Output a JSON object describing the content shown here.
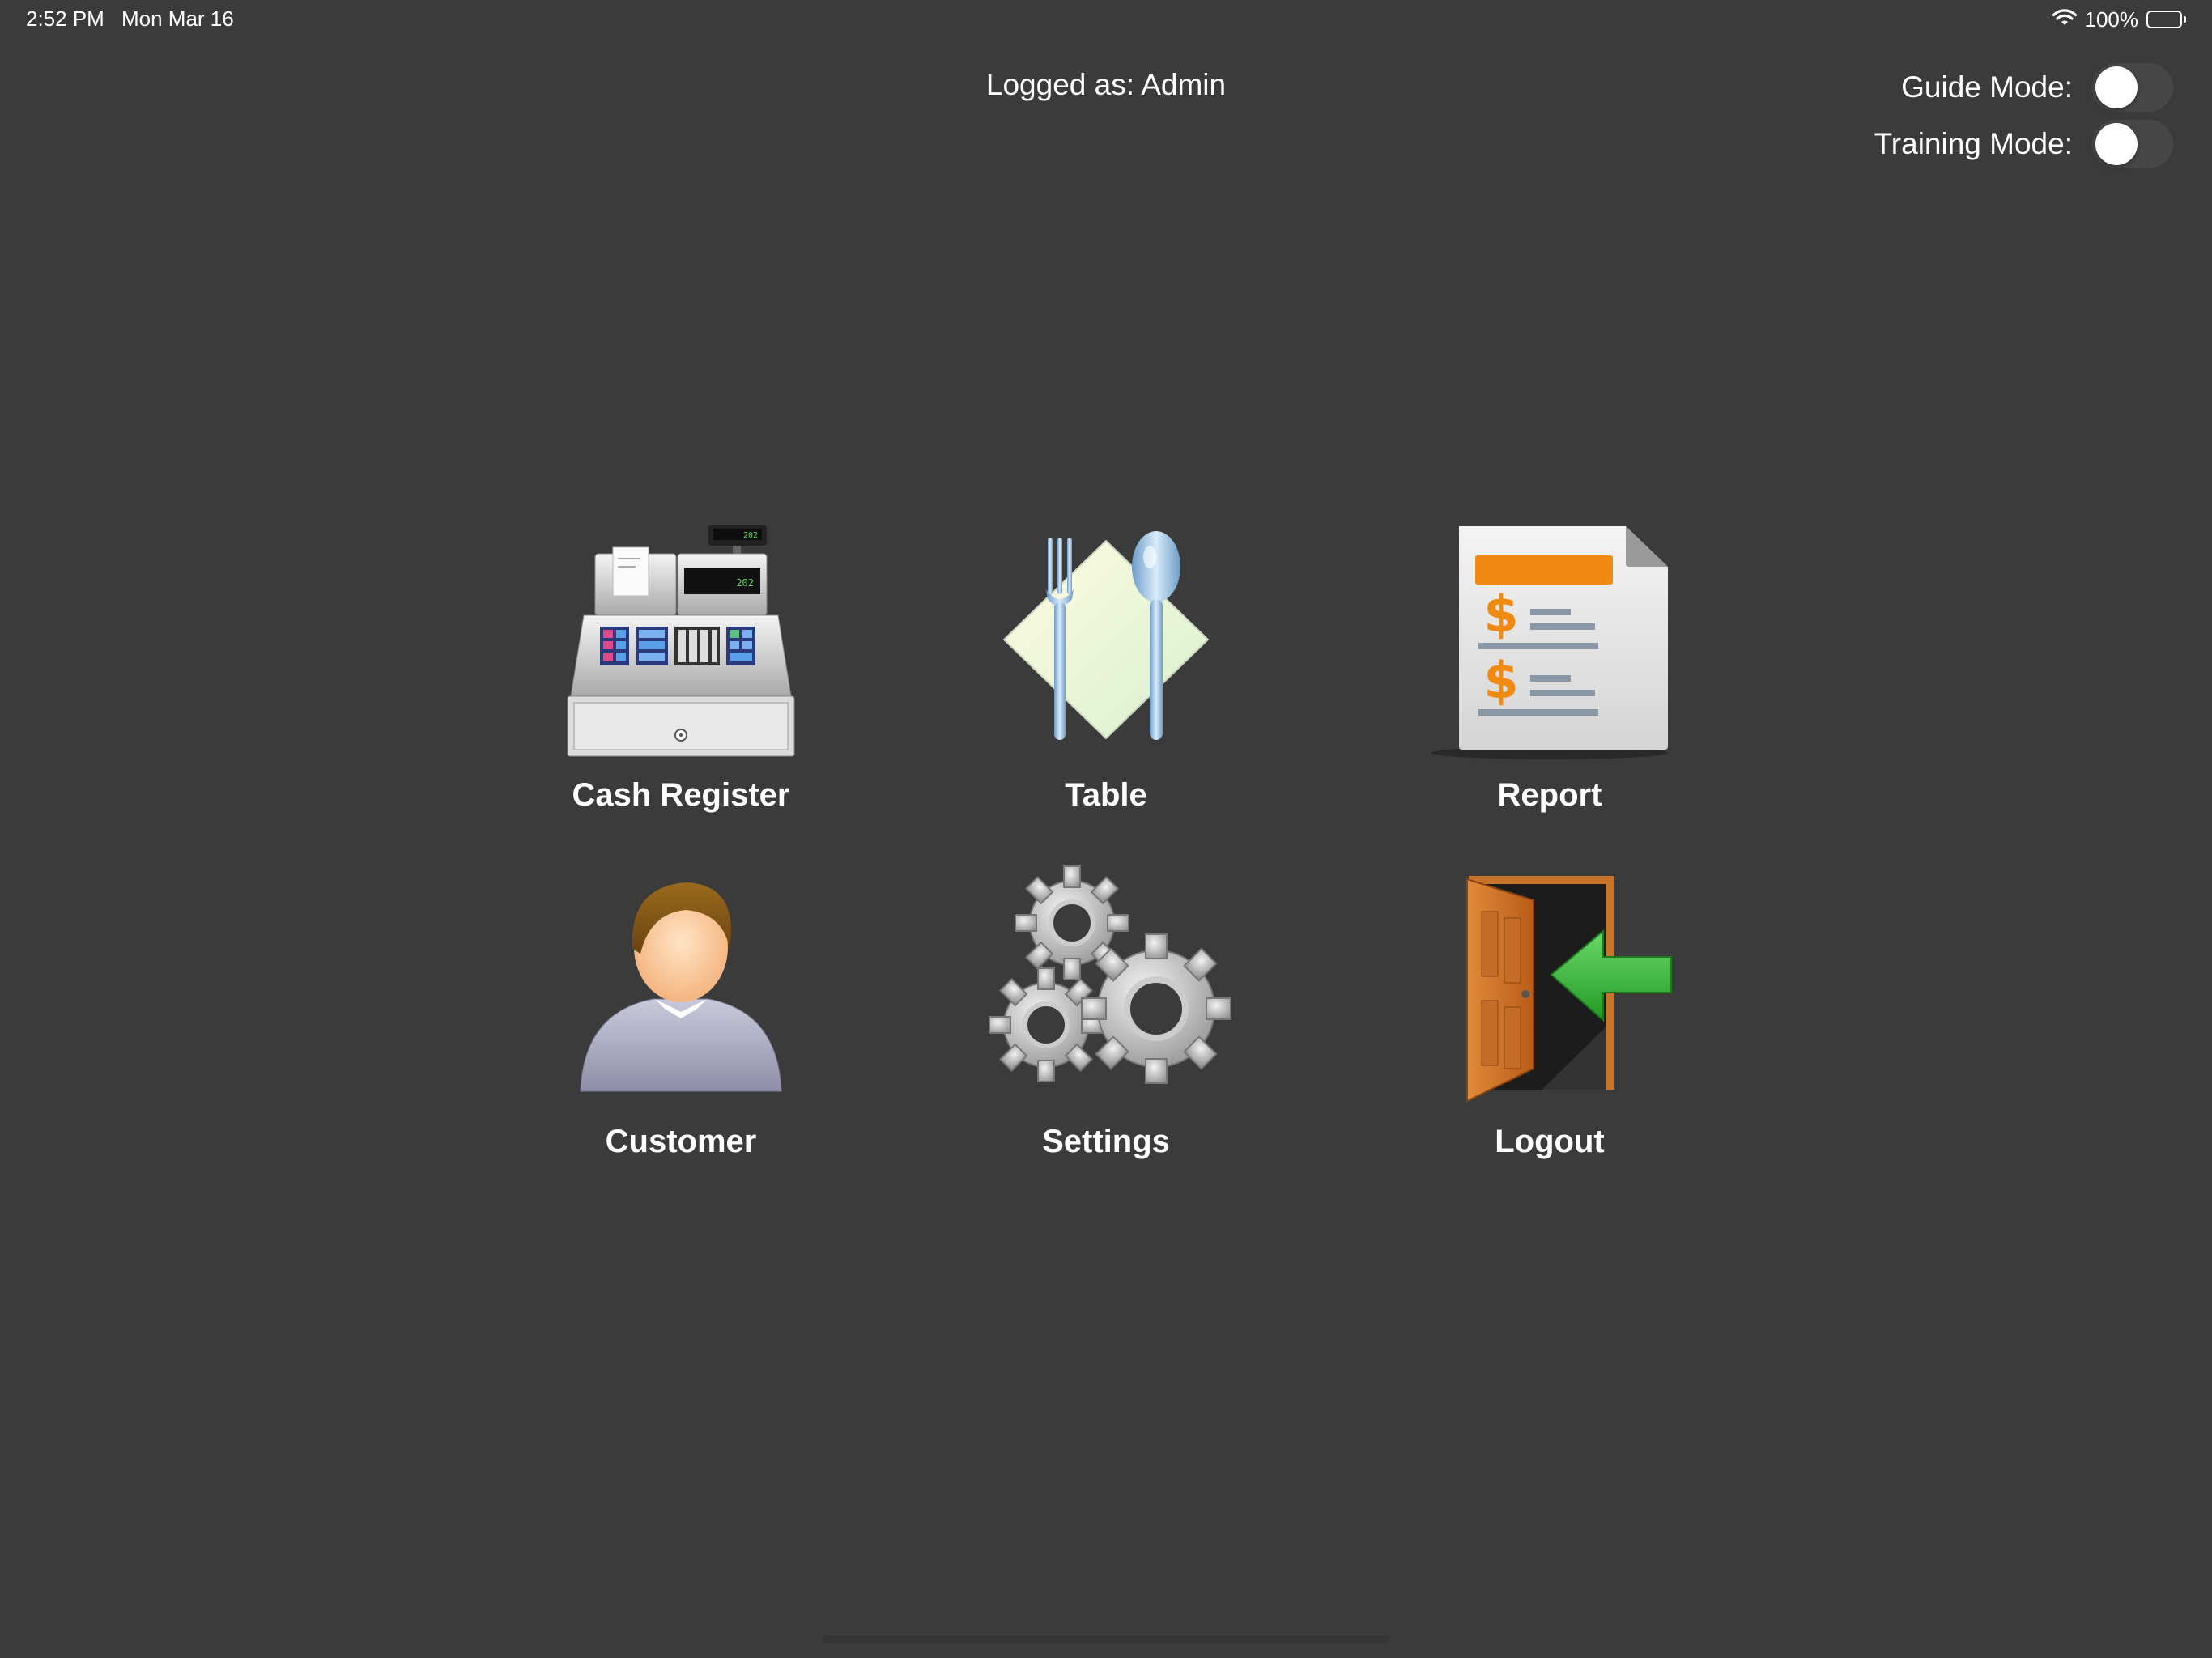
{
  "status_bar": {
    "time": "2:52 PM",
    "date": "Mon Mar 16",
    "battery_percent": "100%",
    "battery_level": 1.0
  },
  "header": {
    "logged_as": "Logged as: Admin"
  },
  "modes": {
    "guide": {
      "label": "Guide Mode:",
      "enabled": false
    },
    "training": {
      "label": "Training Mode:",
      "enabled": false
    }
  },
  "menu": [
    {
      "id": "cash-register",
      "label": "Cash Register",
      "icon": "cash-register-icon"
    },
    {
      "id": "table",
      "label": "Table",
      "icon": "fork-spoon-icon"
    },
    {
      "id": "report",
      "label": "Report",
      "icon": "report-document-icon"
    },
    {
      "id": "customer",
      "label": "Customer",
      "icon": "customer-person-icon"
    },
    {
      "id": "settings",
      "label": "Settings",
      "icon": "gears-icon"
    },
    {
      "id": "logout",
      "label": "Logout",
      "icon": "door-exit-icon"
    }
  ],
  "colors": {
    "background": "#3b3b3b",
    "text": "#ffffff",
    "toggle_track": "#474747",
    "logout_arrow": "#3aa83a",
    "report_orange": "#f08a12"
  }
}
